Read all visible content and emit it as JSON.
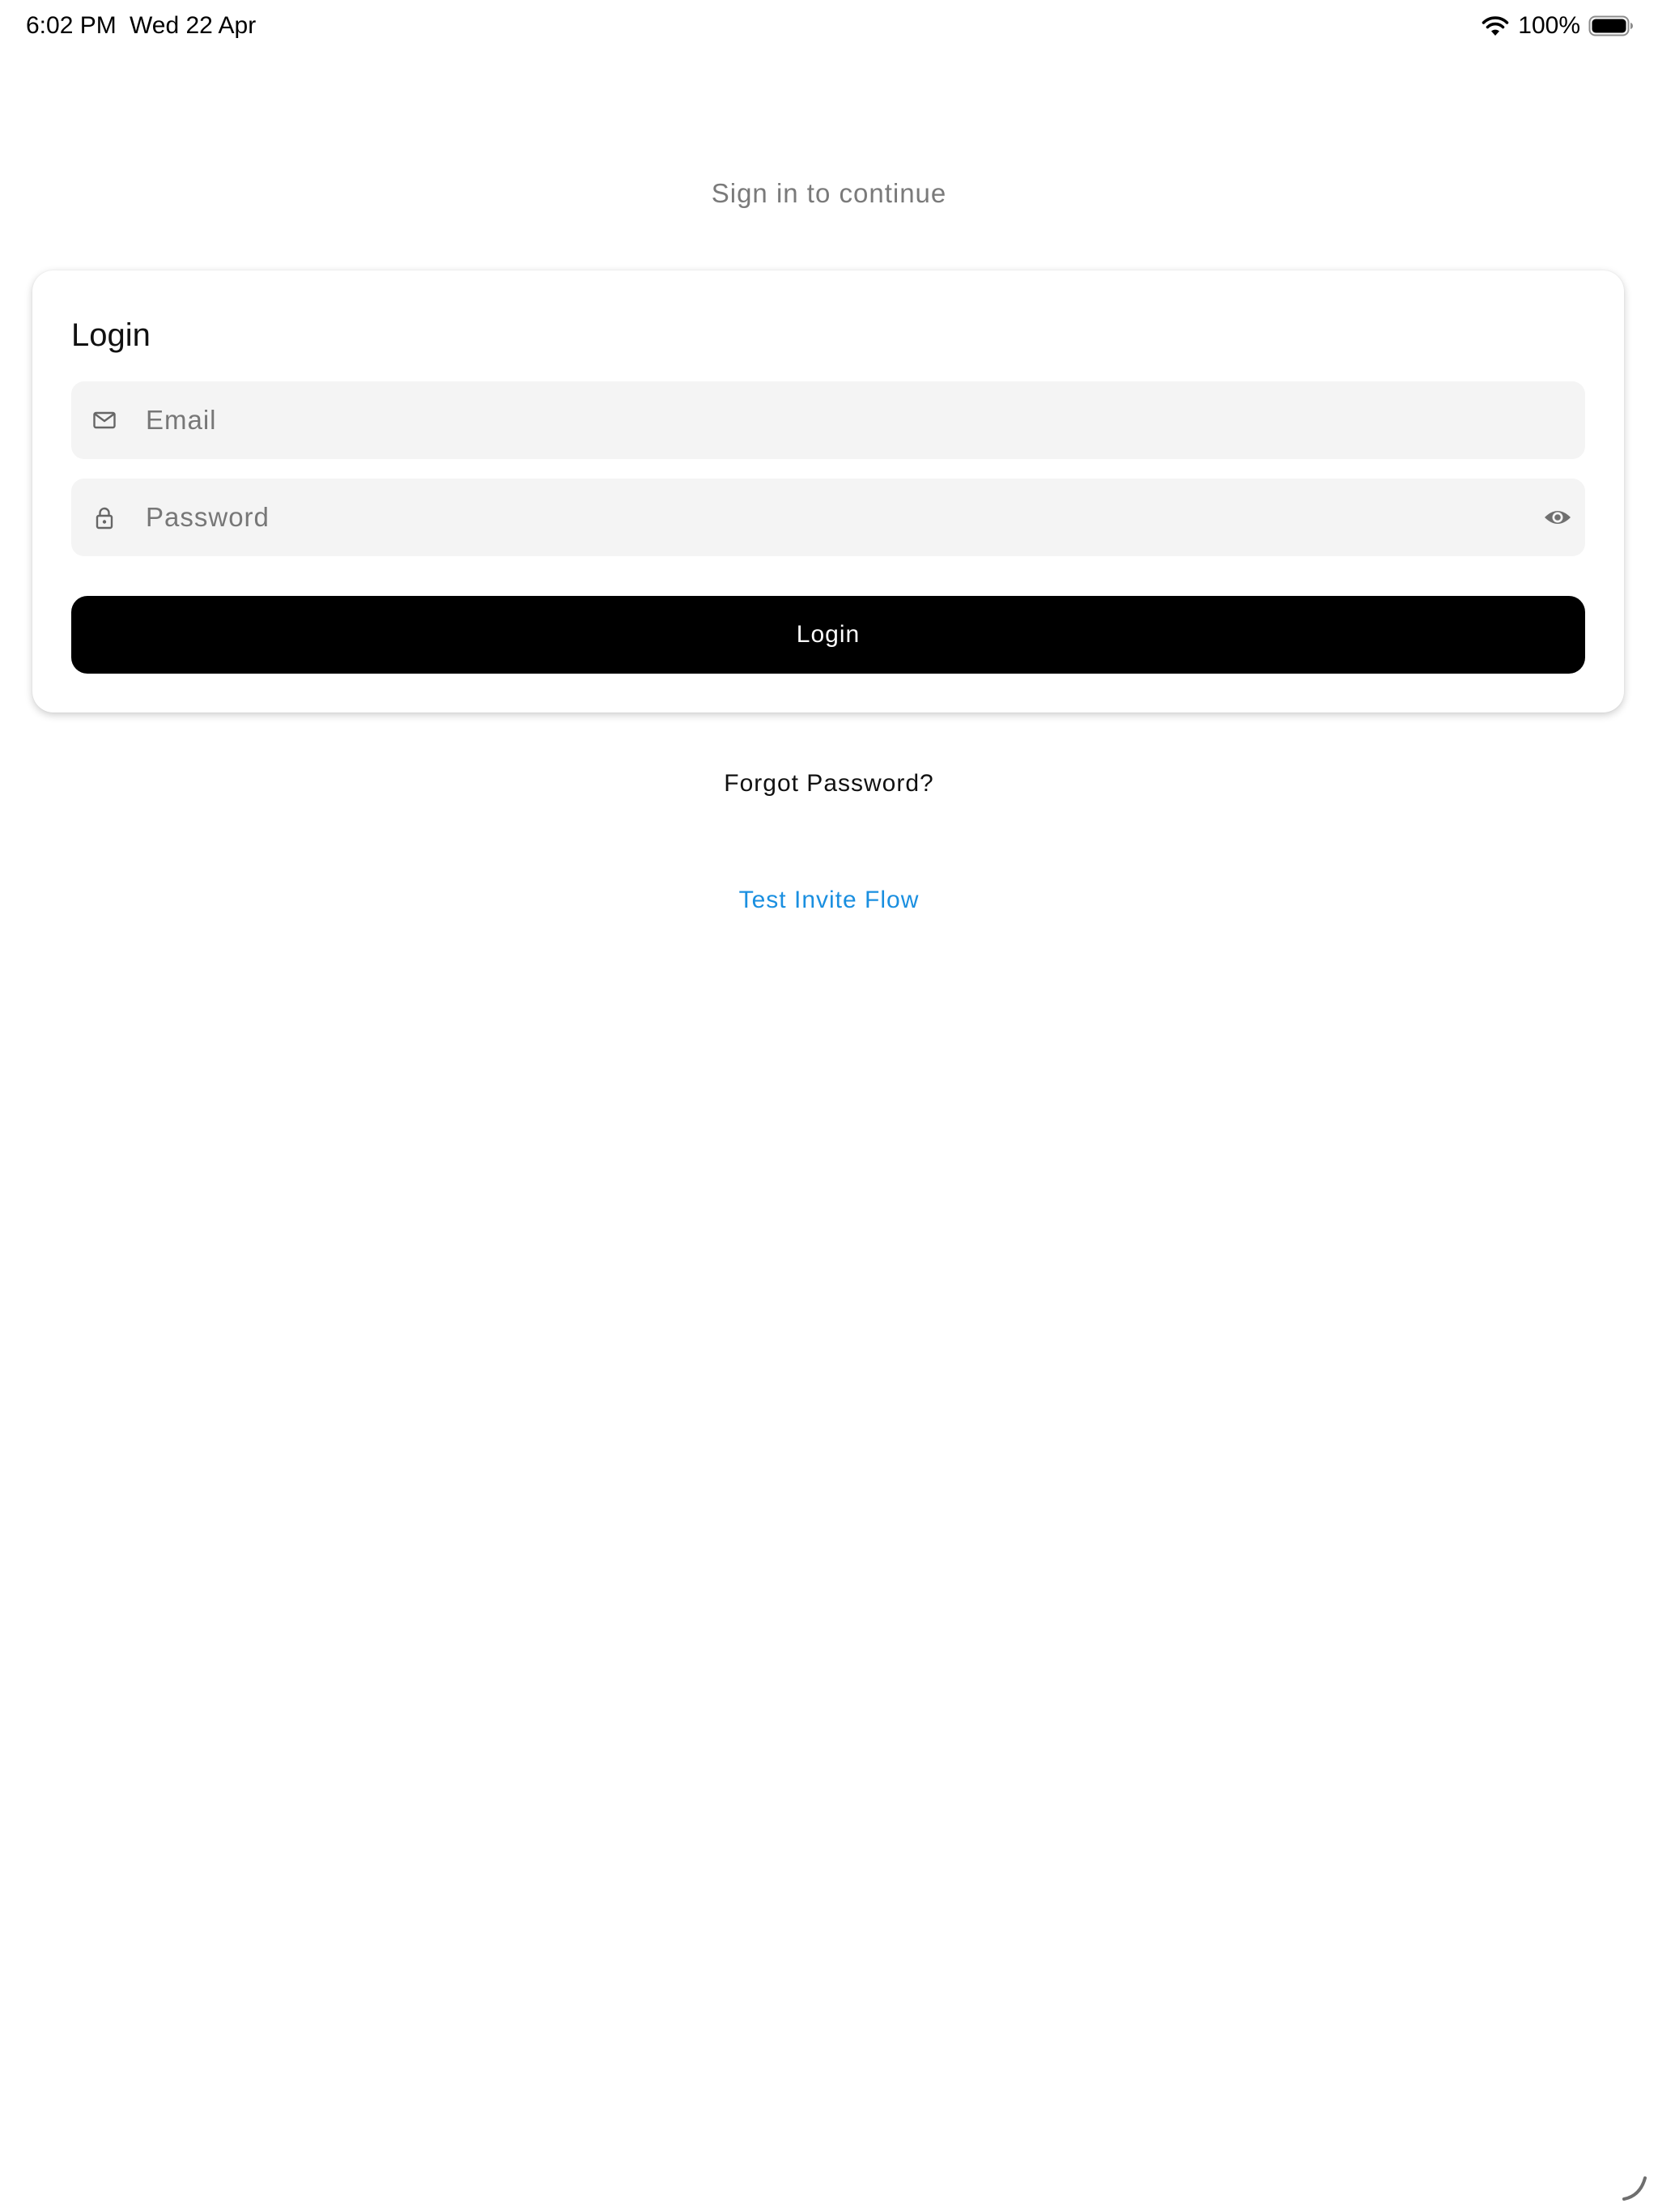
{
  "status_bar": {
    "time": "6:02 PM",
    "date": "Wed 22 Apr",
    "battery_percent": "100%",
    "wifi_icon": "wifi-icon",
    "battery_icon": "battery-full-icon"
  },
  "subtitle": "Sign in to continue",
  "login_card": {
    "title": "Login",
    "email_field": {
      "placeholder": "Email",
      "value": "",
      "icon": "mail-icon"
    },
    "password_field": {
      "placeholder": "Password",
      "value": "",
      "icon": "lock-icon",
      "trailing_icon": "eye-icon"
    },
    "login_button_label": "Login"
  },
  "forgot_password_label": "Forgot Password?",
  "test_invite_label": "Test Invite Flow",
  "colors": {
    "background": "#ffffff",
    "field_background": "#f4f4f4",
    "button_background": "#000000",
    "button_text": "#ffffff",
    "subtitle_text": "#7a7a7a",
    "link_accent": "#1a8fe0"
  }
}
